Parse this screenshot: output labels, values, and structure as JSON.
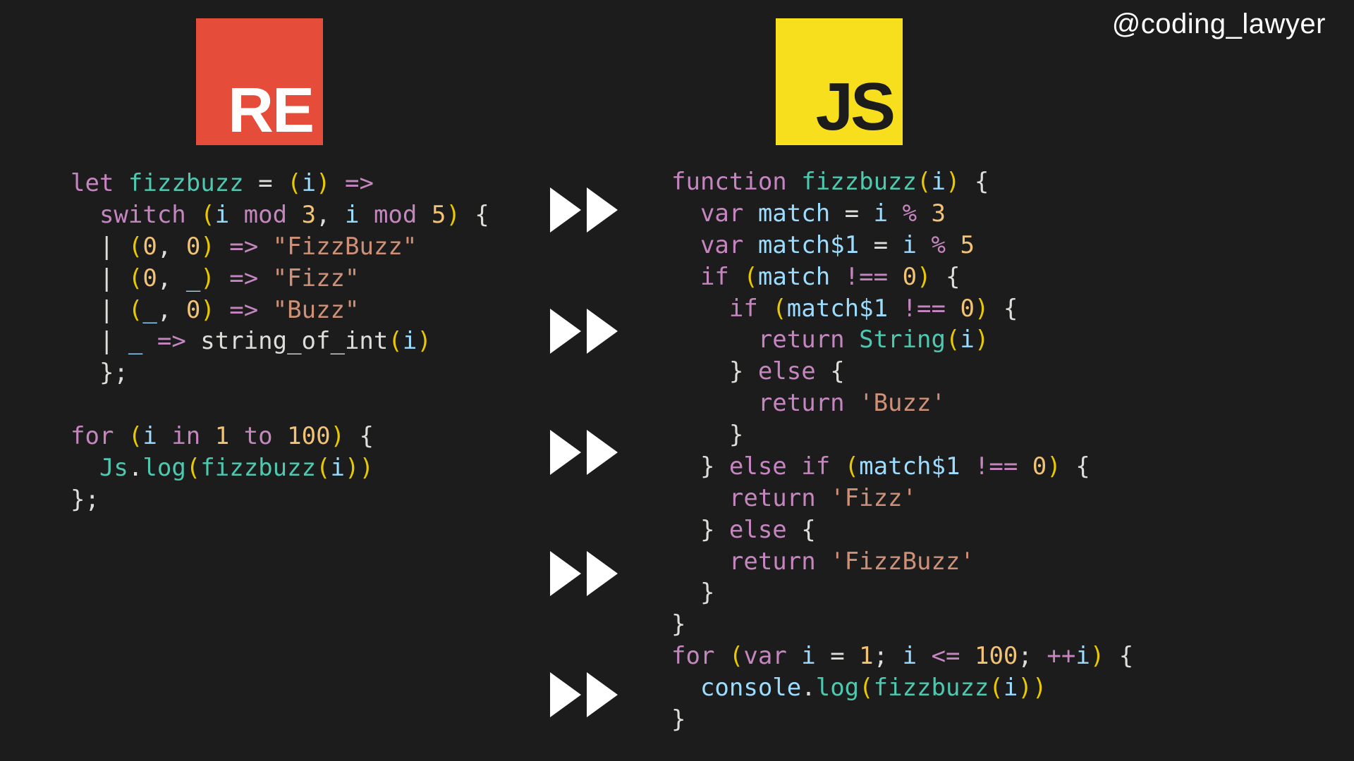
{
  "handle": "@coding_lawyer",
  "logos": {
    "reason": "RE",
    "js": "JS"
  },
  "reason_code": {
    "l0_let": "let",
    "l0_name": " fizzbuzz ",
    "l0_eq": "= ",
    "l0_par_o": "(",
    "l0_i": "i",
    "l0_par_c": ")",
    "l0_arrow": " =>",
    "l1_sw": "  switch ",
    "l1_p": "(",
    "l1_i1": "i ",
    "l1_mod1": "mod",
    "l1_n3": " 3",
    "l1_comma": ", ",
    "l1_i2": "i ",
    "l1_mod2": "mod",
    "l1_n5": " 5",
    "l1_pc": ")",
    "l1_brace": " {",
    "l2": "  | ",
    "l2_p": "(",
    "l2_n0a": "0",
    "l2_c": ", ",
    "l2_n0b": "0",
    "l2_pc": ")",
    "l2_ar": " => ",
    "l2_s": "\"FizzBuzz\"",
    "l3": "  | ",
    "l3_p": "(",
    "l3_n0": "0",
    "l3_c": ", ",
    "l3_u": "_",
    "l3_pc": ")",
    "l3_ar": " => ",
    "l3_s": "\"Fizz\"",
    "l4": "  | ",
    "l4_p": "(",
    "l4_u": "_",
    "l4_c": ", ",
    "l4_n0": "0",
    "l4_pc": ")",
    "l4_ar": " => ",
    "l4_s": "\"Buzz\"",
    "l5": "  | ",
    "l5_u": "_ ",
    "l5_ar": "=> ",
    "l5_fn": "string_of_int",
    "l5_p": "(",
    "l5_i": "i",
    "l5_pc": ")",
    "l6": "  };",
    "blank": "",
    "l8_for": "for ",
    "l8_p": "(",
    "l8_i": "i ",
    "l8_in": "in",
    "l8_n1": " 1 ",
    "l8_to": "to",
    "l8_n100": " 100",
    "l8_pc": ")",
    "l8_b": " {",
    "l9_pad": "  ",
    "l9_js": "Js",
    "l9_dot": ".",
    "l9_log": "log",
    "l9_p": "(",
    "l9_fb": "fizzbuzz",
    "l9_p2": "(",
    "l9_i": "i",
    "l9_pc2": ")",
    "l9_pc": ")",
    "l10": "};"
  },
  "js_code": {
    "l0_fn": "function",
    "l0_name": " fizzbuzz",
    "l0_p": "(",
    "l0_i": "i",
    "l0_pc": ")",
    "l0_b": " {",
    "l1_var": "  var",
    "l1_m": " match ",
    "l1_eq": "= ",
    "l1_i": "i ",
    "l1_op": "%",
    "l1_n": " 3",
    "l2_var": "  var",
    "l2_m": " match$1 ",
    "l2_eq": "= ",
    "l2_i": "i ",
    "l2_op": "%",
    "l2_n": " 5",
    "l3_if": "  if ",
    "l3_p": "(",
    "l3_m": "match ",
    "l3_ne": "!==",
    "l3_n": " 0",
    "l3_pc": ")",
    "l3_b": " {",
    "l4_if": "    if ",
    "l4_p": "(",
    "l4_m": "match$1 ",
    "l4_ne": "!==",
    "l4_n": " 0",
    "l4_pc": ")",
    "l4_b": " {",
    "l5_ret": "      return ",
    "l5_str": "String",
    "l5_p": "(",
    "l5_i": "i",
    "l5_pc": ")",
    "l6_else": "    } ",
    "l6_kw": "else",
    "l6_b": " {",
    "l7_ret": "      return ",
    "l7_s": "'Buzz'",
    "l8": "    }",
    "l9_else": "  } ",
    "l9_kw": "else if ",
    "l9_p": "(",
    "l9_m": "match$1 ",
    "l9_ne": "!==",
    "l9_n": " 0",
    "l9_pc": ")",
    "l9_b": " {",
    "l10_ret": "    return ",
    "l10_s": "'Fizz'",
    "l11_else": "  } ",
    "l11_kw": "else",
    "l11_b": " {",
    "l12_ret": "    return ",
    "l12_s": "'FizzBuzz'",
    "l13": "  }",
    "l14": "}",
    "l15_for": "for ",
    "l15_p": "(",
    "l15_var": "var",
    "l15_i": " i ",
    "l15_eq": "= ",
    "l15_n1": "1",
    "l15_sc": "; ",
    "l15_i2": "i ",
    "l15_le": "<=",
    "l15_n100": " 100",
    "l15_sc2": "; ",
    "l15_pp": "++",
    "l15_i3": "i",
    "l15_pc": ")",
    "l15_b": " {",
    "l16_pad": "  ",
    "l16_con": "console",
    "l16_dot": ".",
    "l16_log": "log",
    "l16_p": "(",
    "l16_fb": "fizzbuzz",
    "l16_p2": "(",
    "l16_i": "i",
    "l16_pc2": ")",
    "l16_pc": ")",
    "l17": "}"
  }
}
